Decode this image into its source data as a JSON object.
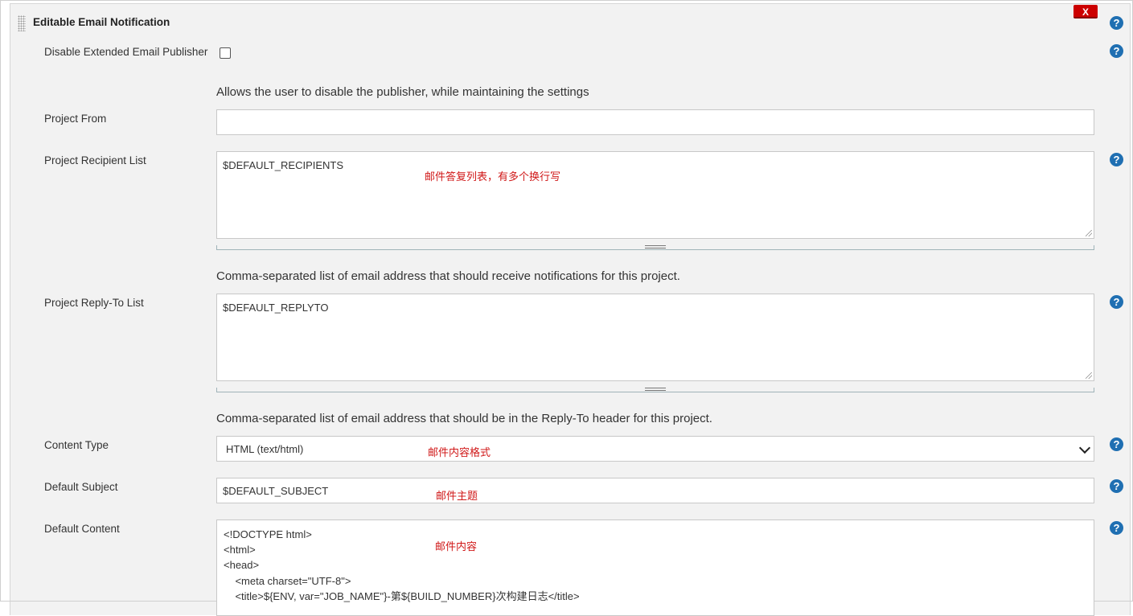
{
  "section": {
    "title": "Editable Email Notification",
    "delete_label": "X",
    "help_glyph": "?"
  },
  "disable_publisher": {
    "label": "Disable Extended Email Publisher",
    "checked": false,
    "description": "Allows the user to disable the publisher, while maintaining the settings"
  },
  "project_from": {
    "label": "Project From",
    "value": ""
  },
  "recipient_list": {
    "label": "Project Recipient List",
    "value": "$DEFAULT_RECIPIENTS",
    "annotation": "邮件答复列表，有多个换行写",
    "description": "Comma-separated list of email address that should receive notifications for this project."
  },
  "reply_to_list": {
    "label": "Project Reply-To List",
    "value": "$DEFAULT_REPLYTO",
    "description": "Comma-separated list of email address that should be in the Reply-To header for this project."
  },
  "content_type": {
    "label": "Content Type",
    "selected": "HTML (text/html)",
    "annotation": "邮件内容格式"
  },
  "default_subject": {
    "label": "Default Subject",
    "value": "$DEFAULT_SUBJECT",
    "annotation": "邮件主题"
  },
  "default_content": {
    "label": "Default Content",
    "annotation": "邮件内容",
    "lines": [
      "<!DOCTYPE html>",
      "<html>",
      "<head>",
      "    <meta charset=\"UTF-8\">",
      "    <title>${ENV, var=\"JOB_NAME\"}-第${BUILD_NUMBER}次构建日志</title>"
    ]
  },
  "colors": {
    "panel_bg": "#f2f2f2",
    "help_icon": "#1f6fb2",
    "delete_button": "#cc0000",
    "annotation_red": "#d01818"
  }
}
